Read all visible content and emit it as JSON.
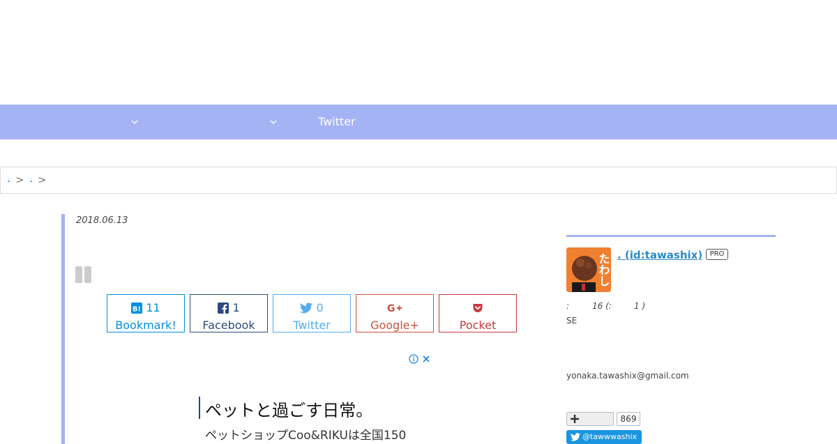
{
  "nav": {
    "items": [
      {
        "label": ""
      },
      {
        "label": ""
      },
      {
        "label": "Twitter"
      }
    ]
  },
  "breadcrumb": {
    "items": [
      {
        "label": "."
      },
      {
        "label": "."
      }
    ],
    "separator": ">"
  },
  "article": {
    "date": "2018.06.13"
  },
  "share": {
    "hatena": {
      "count": "11",
      "label": "Bookmark!"
    },
    "facebook": {
      "count": "1",
      "label": "Facebook"
    },
    "twitter": {
      "count": "0",
      "label": "Twitter"
    },
    "google": {
      "label": "Google+"
    },
    "pocket": {
      "label": "Pocket"
    }
  },
  "ad": {
    "title": "ペットと過ごす日常。",
    "subtitle": "ペットショップCoo&RIKUは全国150"
  },
  "profile": {
    "name": ". (id:tawashix)",
    "badge": "PRO",
    "avatar_text": "たわし",
    "stats_prefix": ":",
    "stats_days": "16 (:",
    "stats_suffix": "1 )",
    "note": "SE",
    "email": "yonaka.tawashix@gmail.com",
    "follow_count": "869",
    "twitter_handle": "@tawwwashix"
  },
  "colors": {
    "nav": "#a3b3f4",
    "hatena": "#008fde",
    "facebook": "#2b4a7e",
    "twitter": "#55acee",
    "google": "#c8533e",
    "pocket": "#c8383f"
  }
}
